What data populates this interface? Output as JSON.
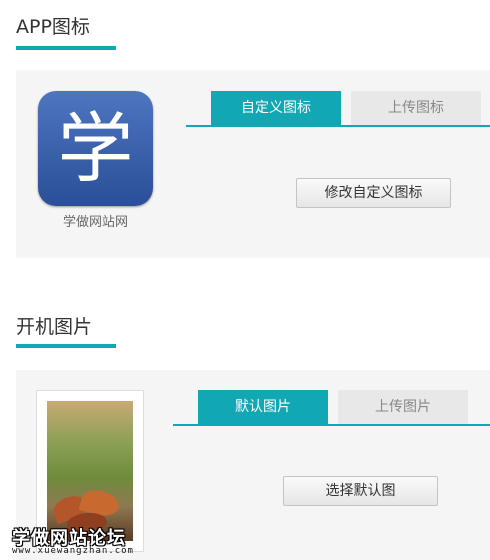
{
  "app_icon_section": {
    "title": "APP图标",
    "icon_char": "学",
    "app_name": "学做网站网",
    "tabs": [
      {
        "label": "自定义图标",
        "active": true
      },
      {
        "label": "上传图标",
        "active": false
      }
    ],
    "action_button": "修改自定义图标"
  },
  "boot_image_section": {
    "title": "开机图片",
    "tabs": [
      {
        "label": "默认图片",
        "active": true
      },
      {
        "label": "上传图片",
        "active": false
      }
    ],
    "action_button": "选择默认图"
  },
  "watermark": {
    "name": "学做网站论坛",
    "url": "www.xuewangzhan.com"
  },
  "colors": {
    "accent": "#12a8b3",
    "panel_bg": "#f5f5f5",
    "tab_inactive_bg": "#e8e8e8",
    "icon_bg": "#3a60ad"
  }
}
